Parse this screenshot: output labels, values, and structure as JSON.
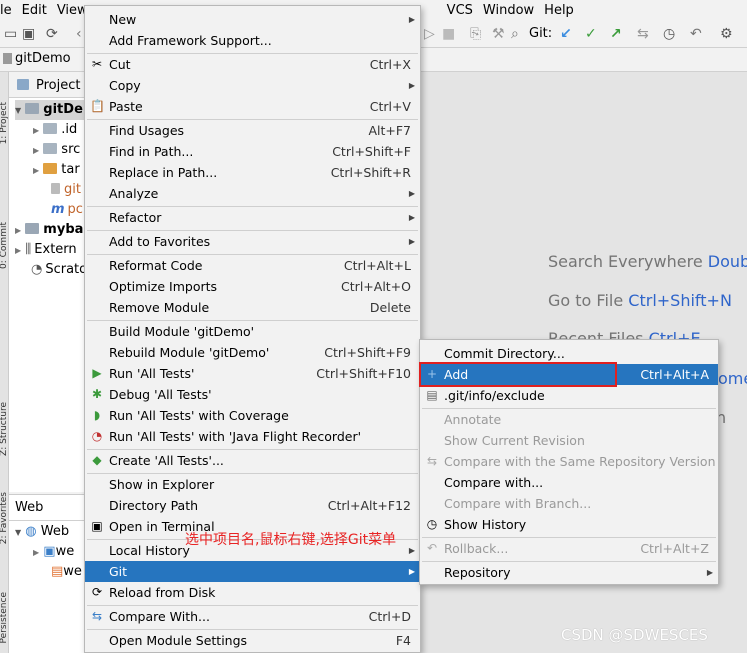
{
  "menubar": [
    "le",
    "Edit",
    "View",
    "VCS",
    "Window",
    "Help"
  ],
  "toolbar": {
    "git_label": "Git:"
  },
  "navbar": {
    "breadcrumb": "gitDemo"
  },
  "tool_tabs": [
    "1: Project",
    "0: Commit",
    "Z: Structure",
    "2: Favorites",
    "Persistence"
  ],
  "project_panel": {
    "title": "Project",
    "tree": [
      "gitDe",
      ".id",
      "src",
      "tar",
      "git",
      "pc",
      "myba",
      "Extern",
      "Scrato"
    ]
  },
  "web_panel": {
    "title": "Web",
    "tree": [
      "Web",
      "we",
      "we"
    ]
  },
  "editor_hints": [
    {
      "text": "Search Everywhere",
      "key": "Double"
    },
    {
      "text": "Go to File",
      "key": "Ctrl+Shift+N"
    },
    {
      "text": "Recent Files",
      "key": "Ctrl+E"
    },
    {
      "text": "",
      "key": "ome"
    },
    {
      "text": "n",
      "key": ""
    }
  ],
  "context_menu": {
    "new": "New",
    "add_framework": "Add Framework Support...",
    "cut": {
      "label": "Cut",
      "shortcut": "Ctrl+X"
    },
    "copy": "Copy",
    "paste": {
      "label": "Paste",
      "shortcut": "Ctrl+V"
    },
    "find_usages": {
      "label": "Find Usages",
      "shortcut": "Alt+F7"
    },
    "find_in_path": {
      "label": "Find in Path...",
      "shortcut": "Ctrl+Shift+F"
    },
    "replace_in_path": {
      "label": "Replace in Path...",
      "shortcut": "Ctrl+Shift+R"
    },
    "analyze": "Analyze",
    "refactor": "Refactor",
    "add_to_favorites": "Add to Favorites",
    "reformat_code": {
      "label": "Reformat Code",
      "shortcut": "Ctrl+Alt+L"
    },
    "optimize_imports": {
      "label": "Optimize Imports",
      "shortcut": "Ctrl+Alt+O"
    },
    "remove_module": {
      "label": "Remove Module",
      "shortcut": "Delete"
    },
    "build_module": "Build Module 'gitDemo'",
    "rebuild_module": {
      "label": "Rebuild Module 'gitDemo'",
      "shortcut": "Ctrl+Shift+F9"
    },
    "run_tests": {
      "label": "Run 'All Tests'",
      "shortcut": "Ctrl+Shift+F10"
    },
    "debug_tests": "Debug 'All Tests'",
    "run_coverage": "Run 'All Tests' with Coverage",
    "run_jfr": "Run 'All Tests' with 'Java Flight Recorder'",
    "create_tests": "Create 'All Tests'...",
    "show_in_explorer": "Show in Explorer",
    "directory_path": {
      "label": "Directory Path",
      "shortcut": "Ctrl+Alt+F12"
    },
    "open_terminal": "Open in Terminal",
    "local_history": "Local History",
    "git": "Git",
    "reload": "Reload from Disk",
    "compare_with": {
      "label": "Compare With...",
      "shortcut": "Ctrl+D"
    },
    "module_settings": {
      "label": "Open Module Settings",
      "shortcut": "F4"
    }
  },
  "git_submenu": {
    "commit_directory": "Commit Directory...",
    "add": {
      "label": "Add",
      "shortcut": "Ctrl+Alt+A"
    },
    "exclude": ".git/info/exclude",
    "annotate": "Annotate",
    "show_current_revision": "Show Current Revision",
    "compare_same_repo": "Compare with the Same Repository Version",
    "compare_with": "Compare with...",
    "compare_with_branch": "Compare with Branch...",
    "show_history": "Show History",
    "rollback": {
      "label": "Rollback...",
      "shortcut": "Ctrl+Alt+Z"
    },
    "repository": "Repository"
  },
  "annotation": "选中项目名,鼠标右键,选择Git菜单",
  "watermark": "CSDN @SDWESCES",
  "colors": {
    "selection": "#2675bf",
    "highlight_box": "#e02020",
    "annotation_text": "#e82424",
    "hint_key": "#2f65ca"
  }
}
